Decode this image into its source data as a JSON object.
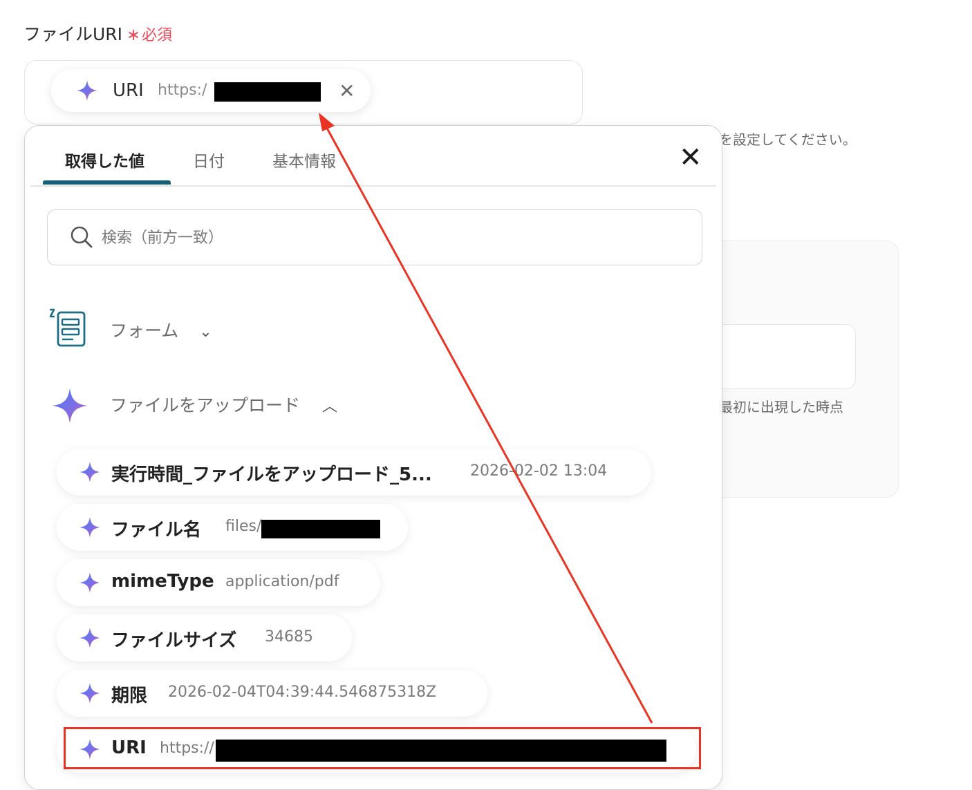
{
  "field": {
    "label": "ファイルURI",
    "required_star": "∗",
    "required_text": "必須"
  },
  "selected_chip": {
    "label": "URI",
    "value_prefix": "https:/",
    "remove_icon": "close-icon"
  },
  "background": {
    "hint_top": "を設定してください。",
    "hint_bottom": "最初に出現した時点"
  },
  "popup": {
    "tabs": [
      {
        "label": "取得した値",
        "active": true
      },
      {
        "label": "日付",
        "active": false
      },
      {
        "label": "基本情報",
        "active": false
      }
    ],
    "close_icon": "close-icon",
    "search": {
      "placeholder": "検索（前方一致）",
      "value": ""
    },
    "groups": [
      {
        "label": "フォーム",
        "icon": "form-icon",
        "expanded": false
      },
      {
        "label": "ファイルをアップロード",
        "icon": "sparkle-icon",
        "expanded": true
      }
    ],
    "items": [
      {
        "label": "実行時間_ファイルをアップロード_5...",
        "value": "2026-02-02 13:04"
      },
      {
        "label": "ファイル名",
        "value": "files/"
      },
      {
        "label": "mimeType",
        "value": "application/pdf"
      },
      {
        "label": "ファイルサイズ",
        "value": "34685"
      },
      {
        "label": "期限",
        "value": "2026-02-04T04:39:44.546875318Z"
      },
      {
        "label": "URI",
        "value": "https://"
      }
    ]
  },
  "colors": {
    "accent_tab": "#14617a",
    "required": "#e94a5a",
    "annotation": "#ea3323"
  }
}
